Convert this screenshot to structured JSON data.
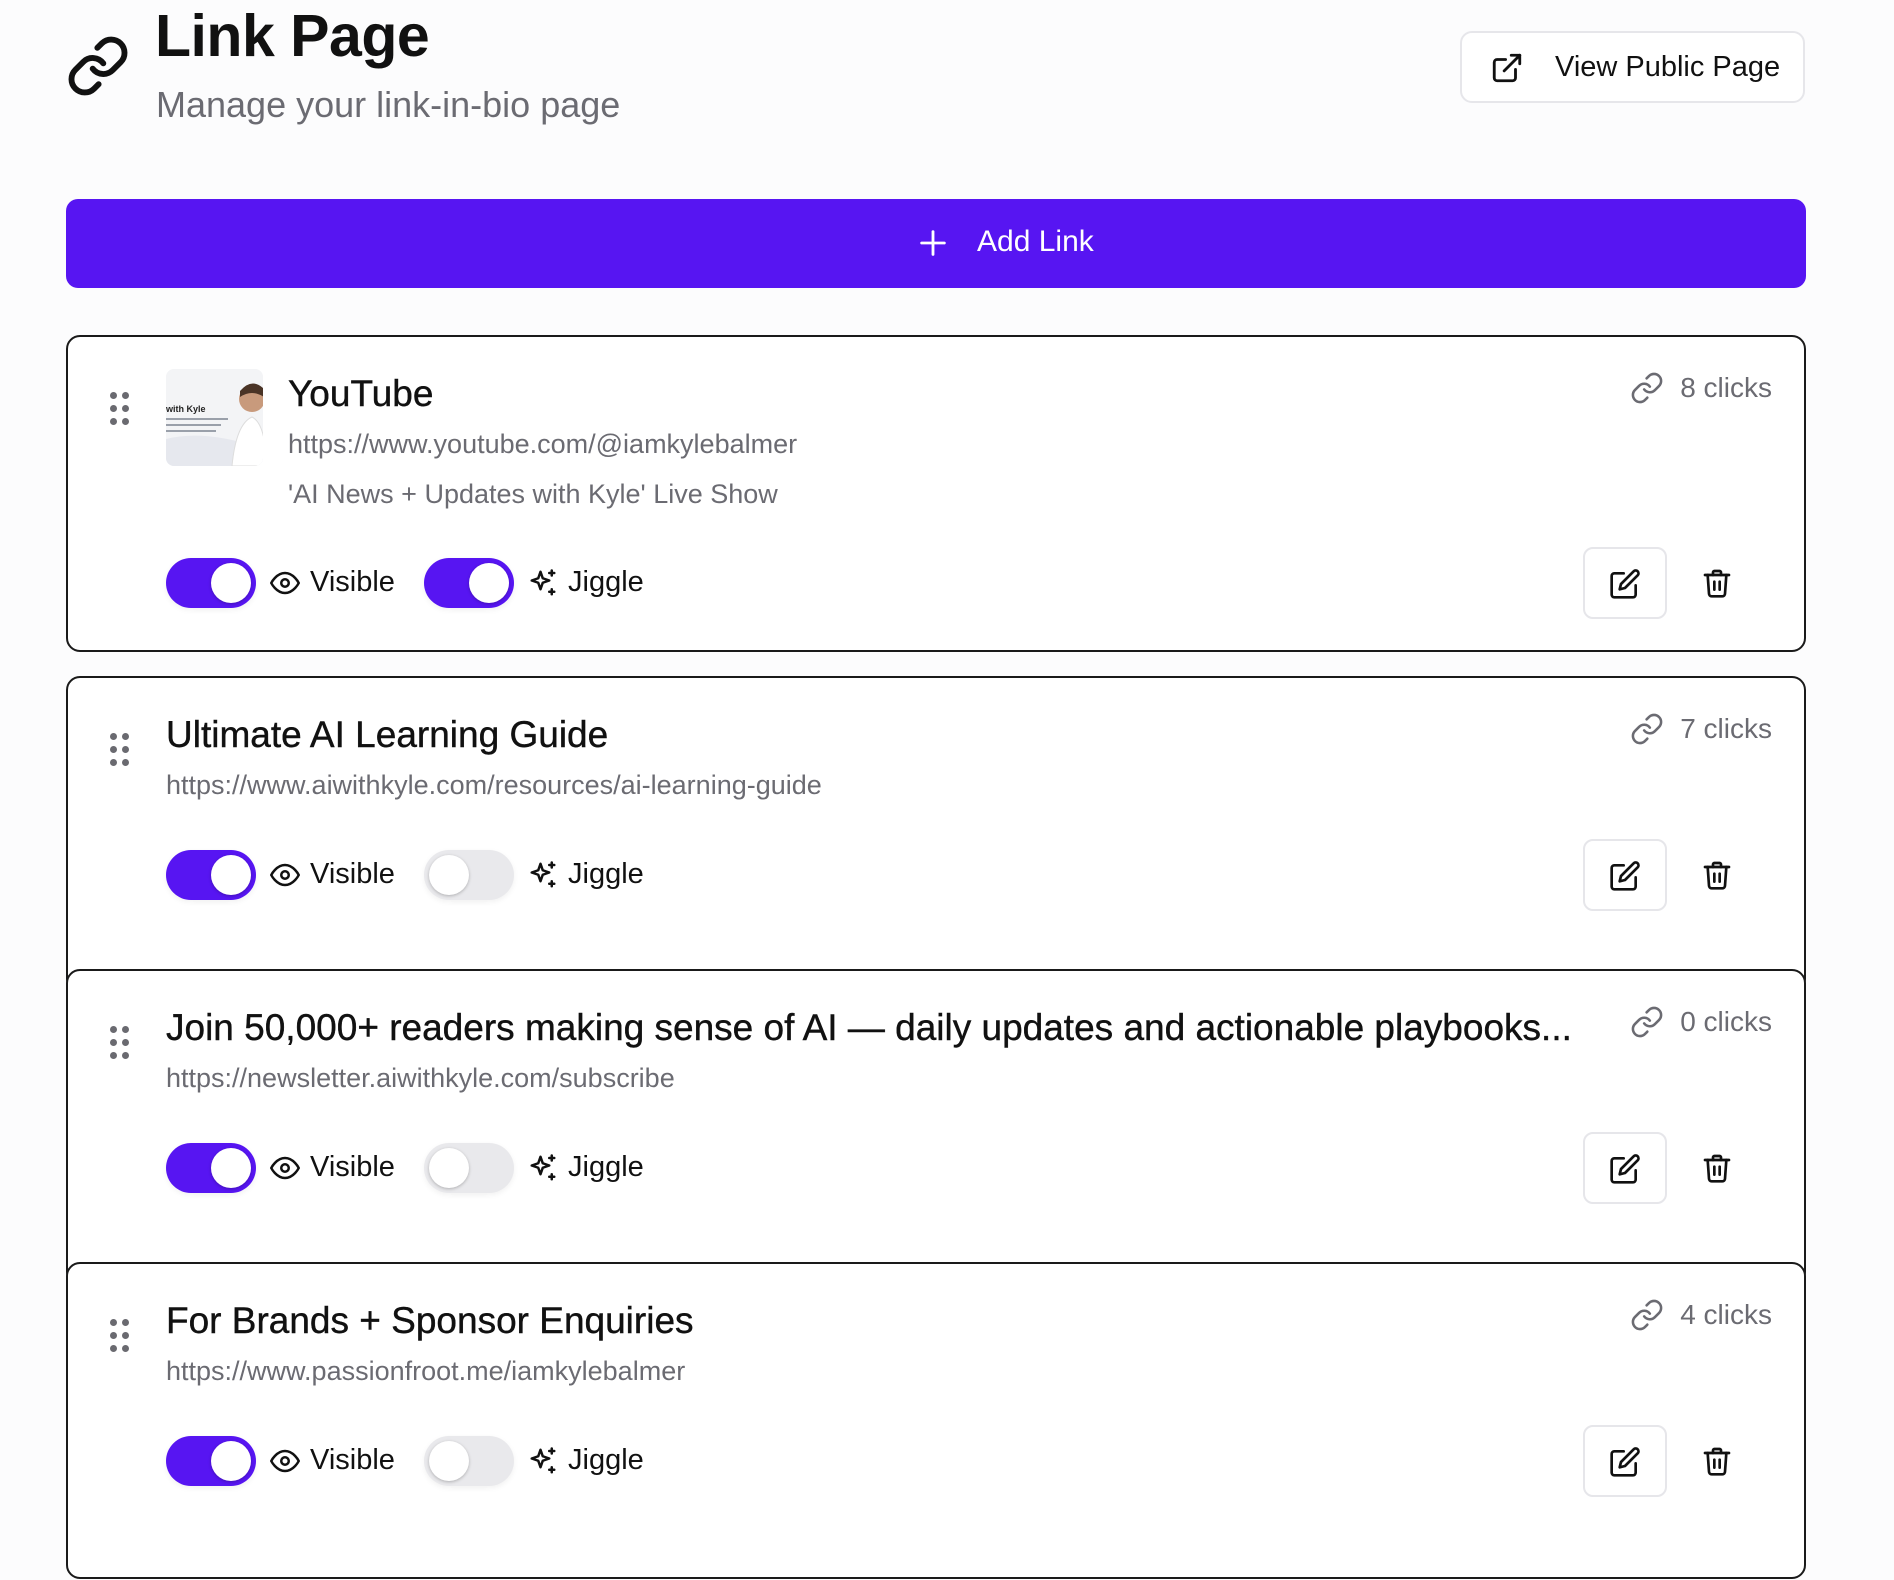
{
  "header": {
    "title": "Link Page",
    "subtitle": "Manage your link-in-bio page",
    "view_public_label": "View Public Page"
  },
  "add_link_label": "Add Link",
  "colors": {
    "accent": "#5715f2",
    "muted_text": "#6b6b72",
    "toggle_off": "#e9e9ec"
  },
  "links": [
    {
      "title": "YouTube",
      "url": "https://www.youtube.com/@iamkylebalmer",
      "description": "'AI News + Updates with Kyle' Live Show",
      "thumbnail_text": "with Kyle",
      "clicks": "8 clicks",
      "visible": true,
      "visible_label": "Visible",
      "jiggle": true,
      "jiggle_label": "Jiggle"
    },
    {
      "title": "Ultimate AI Learning Guide",
      "url": "https://www.aiwithkyle.com/resources/ai-learning-guide",
      "clicks": "7 clicks",
      "visible": true,
      "visible_label": "Visible",
      "jiggle": false,
      "jiggle_label": "Jiggle"
    },
    {
      "title": "Join 50,000+ readers making sense of AI — daily updates and actionable playbooks...",
      "url": "https://newsletter.aiwithkyle.com/subscribe",
      "clicks": "0 clicks",
      "visible": true,
      "visible_label": "Visible",
      "jiggle": false,
      "jiggle_label": "Jiggle"
    },
    {
      "title": "For Brands + Sponsor Enquiries",
      "url": "https://www.passionfroot.me/iamkylebalmer",
      "clicks": "4 clicks",
      "visible": true,
      "visible_label": "Visible",
      "jiggle": false,
      "jiggle_label": "Jiggle"
    }
  ]
}
